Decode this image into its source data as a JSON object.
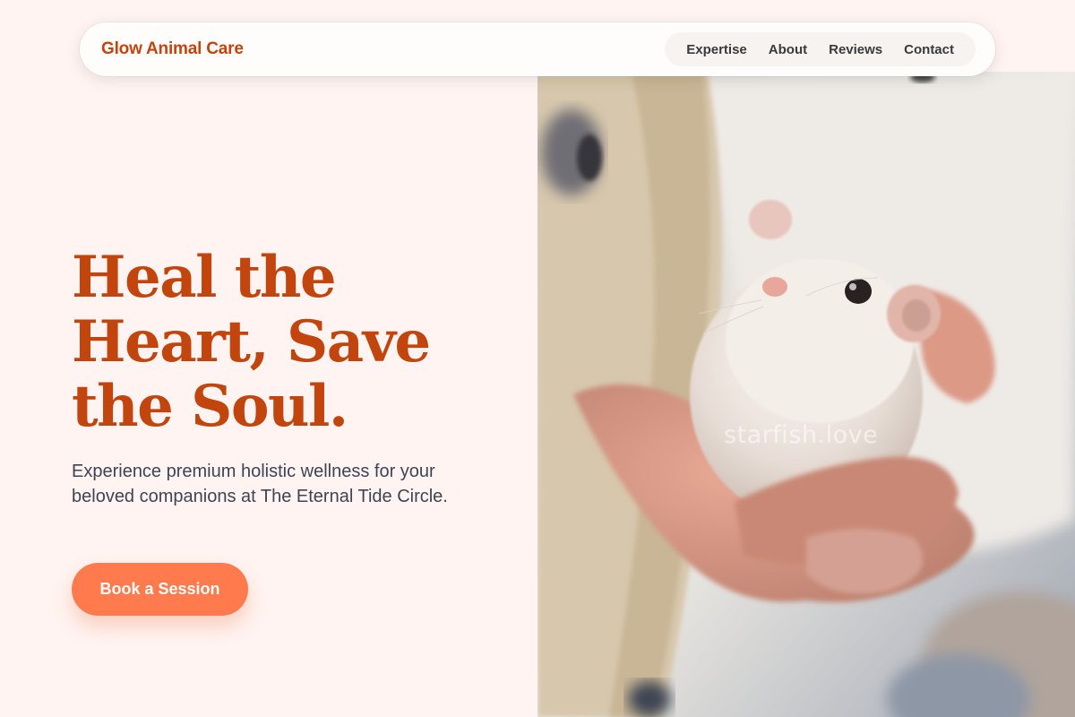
{
  "nav": {
    "brand": "Glow Animal Care",
    "links": [
      {
        "label": "Expertise"
      },
      {
        "label": "About"
      },
      {
        "label": "Reviews"
      },
      {
        "label": "Contact"
      }
    ]
  },
  "hero": {
    "headline": "Heal the Heart, Save the Soul.",
    "subtitle": "Experience premium holistic wellness for your beloved companions at The Eternal Tide Circle.",
    "cta_label": "Book a Session",
    "image_watermark": "starfish.love",
    "image_alt": "Hamster held in a person's hand"
  },
  "colors": {
    "page_bg": "#fff4f1",
    "brand": "#c2450e",
    "headline": "#c2450e",
    "body_text": "#3f4353",
    "cta_bg": "#ff7a4d",
    "cta_text": "#ffffff"
  }
}
